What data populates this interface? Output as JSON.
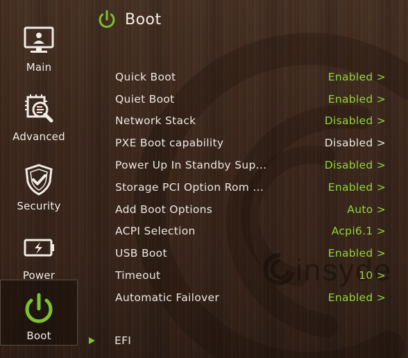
{
  "header": {
    "title": "Boot"
  },
  "sidebar": {
    "items": [
      {
        "label": "Main",
        "icon": "monitor-icon"
      },
      {
        "label": "Advanced",
        "icon": "magnifier-chip-icon"
      },
      {
        "label": "Security",
        "icon": "shield-check-icon"
      },
      {
        "label": "Power",
        "icon": "battery-icon"
      },
      {
        "label": "Boot",
        "icon": "power-icon",
        "active": true
      }
    ]
  },
  "settings": [
    {
      "name": "Quick Boot",
      "value": "Enabled >",
      "color": "green"
    },
    {
      "name": "Quiet Boot",
      "value": "Enabled >",
      "color": "green"
    },
    {
      "name": "Network Stack",
      "value": "Disabled >",
      "color": "green"
    },
    {
      "name": "PXE Boot capability",
      "value": "Disabled >",
      "color": "white"
    },
    {
      "name": "Power Up In Standby Sup...",
      "value": "Disabled >",
      "color": "green"
    },
    {
      "name": "Storage PCI Option Rom ...",
      "value": "Enabled >",
      "color": "green"
    },
    {
      "name": "Add Boot Options",
      "value": "Auto >",
      "color": "green"
    },
    {
      "name": "ACPI Selection",
      "value": "Acpi6.1 >",
      "color": "green"
    },
    {
      "name": "USB Boot",
      "value": "Enabled >",
      "color": "green"
    },
    {
      "name": "Timeout",
      "value": "10 >",
      "color": "green"
    },
    {
      "name": "Automatic Failover",
      "value": "Enabled >",
      "color": "green"
    }
  ],
  "efi": {
    "label": "EFI"
  },
  "brand": {
    "text": "insyde"
  },
  "colors": {
    "accent": "#8fd63a",
    "text": "#ece7e0",
    "background": "#3e2a1f"
  }
}
